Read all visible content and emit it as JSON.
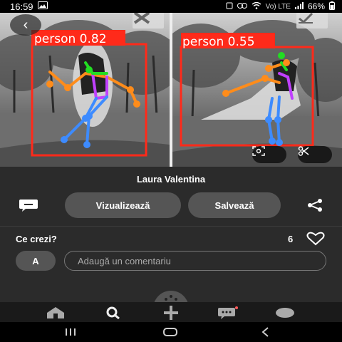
{
  "status_bar": {
    "time": "16:59",
    "right_icons": [
      "sim-icon",
      "nfc-icon",
      "wifi-icon",
      "volte-icon",
      "signal-icon"
    ],
    "network_label": "Vo) LTE",
    "battery": "66%"
  },
  "detections": [
    {
      "label": "person 0.82"
    },
    {
      "label": "person 0.55"
    }
  ],
  "image_actions": {
    "reject_icon": "x-icon",
    "accept_icon": "check-icon",
    "focus_icon": "focus-icon",
    "cut_icon": "scissors-icon"
  },
  "author": "Laura Valentina",
  "actions": {
    "view_label": "Vizualizează",
    "save_label": "Salvează"
  },
  "comments": {
    "question": "Ce crezi?",
    "like_count": "6",
    "avatar_letter": "A",
    "placeholder": "Adaugă un comentariu"
  },
  "nav": [
    "home-icon",
    "search-icon",
    "plus-icon",
    "chat-icon",
    "profile-icon"
  ],
  "colors": {
    "box": "#ff2a1a",
    "pose_arm": "#ff8c1a",
    "pose_leg": "#3d8bff",
    "pose_torso": "#c040ff",
    "pose_head": "#22dd22"
  }
}
